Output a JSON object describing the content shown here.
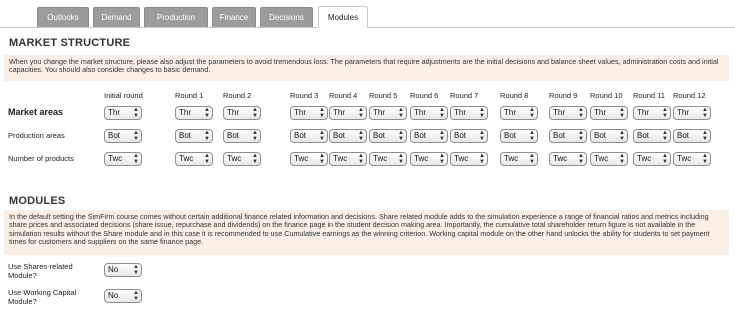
{
  "tabs": [
    {
      "label": "Outlooks",
      "active": false
    },
    {
      "label": "Demand",
      "active": false
    },
    {
      "label": "Production",
      "active": false
    },
    {
      "label": "Finance",
      "active": false
    },
    {
      "label": "Decisions",
      "active": false
    },
    {
      "label": "Modules",
      "active": true
    }
  ],
  "market_structure": {
    "title": "MARKET STRUCTURE",
    "note": "When you change the market structure, please also adjust the parameters to avoid tremendous loss. The parameters that require adjustments are the initial decisions and balance sheet values, administration costs and initial capacities. You should also consider changes to basic demand.",
    "columns": [
      "Initial round",
      "Round 1",
      "Round 2",
      "Round 3",
      "Round 4",
      "Round 5",
      "Round 6",
      "Round 7",
      "Round 8",
      "Round 9",
      "Round 10",
      "Round 11",
      "Round 12"
    ],
    "rows": [
      {
        "label": "Market areas",
        "value": "Thr"
      },
      {
        "label": "Production areas",
        "value": "Bot"
      },
      {
        "label": "Number of products",
        "value": "Twc"
      }
    ]
  },
  "modules": {
    "title": "MODULES",
    "note": "In the default setting the SimFirm course comes without certain additional finance related information and decisions. Share related module adds to the simulation experience a range of financial ratios and metrics including share prices and associated decisions (share issue, repurchase and dividends) on the finance page in the student decision making area. Importantly, the cumulative total shareholder return figure is not available in the simulation results without the Share module and in this case it is recommended to use Cumulative earnings as the winning criterion. Working capital module on the other hand unlocks the ability for students to set payment times for customers and suppliers on the same finance page.",
    "items": [
      {
        "label": "Use Shares-related Module?",
        "value": "No"
      },
      {
        "label": "Use Working Capital Module?",
        "value": "No"
      }
    ]
  },
  "icons": {
    "select_arrows": "up-down-arrows-icon"
  }
}
